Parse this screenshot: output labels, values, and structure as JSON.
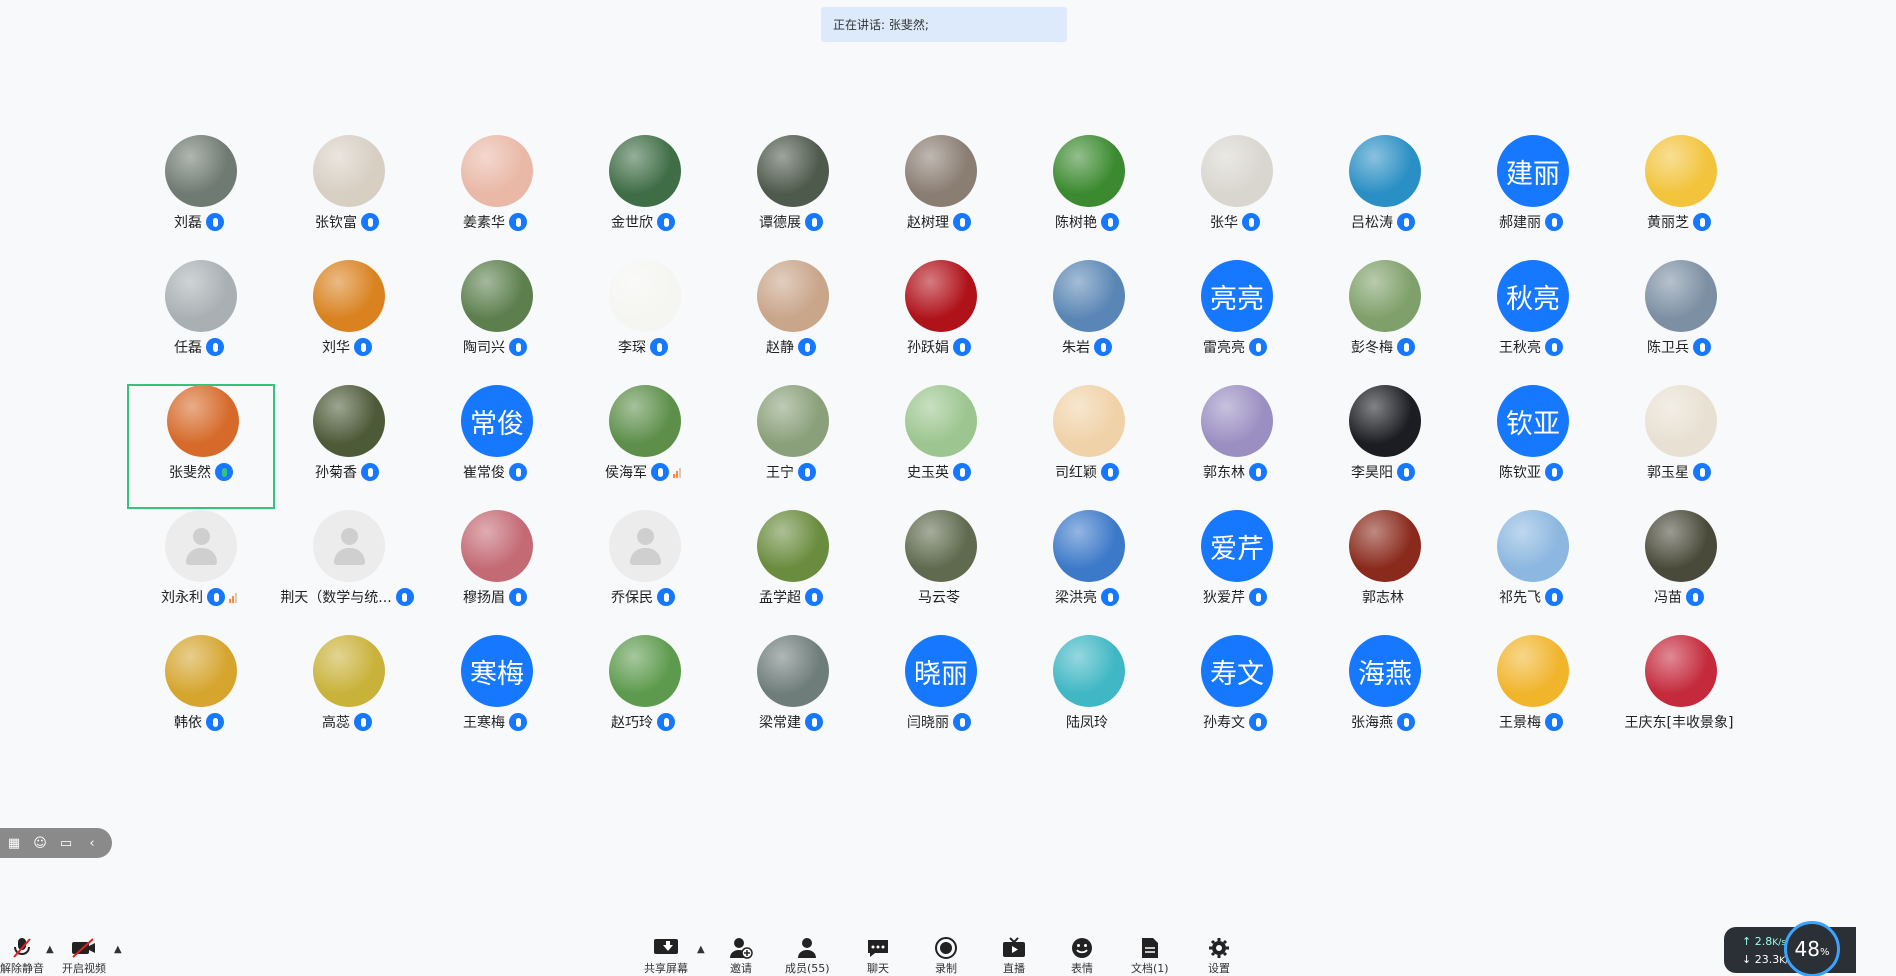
{
  "banner": {
    "text": "正在讲话: 张斐然;"
  },
  "participants": [
    {
      "name": "刘磊",
      "avatar": {
        "kind": "photo",
        "color": "#6f7a72"
      }
    },
    {
      "name": "张钦富",
      "avatar": {
        "kind": "photo",
        "color": "#d8cfc3"
      }
    },
    {
      "name": "姜素华",
      "avatar": {
        "kind": "photo",
        "color": "#e9b8a6"
      }
    },
    {
      "name": "金世欣",
      "avatar": {
        "kind": "photo",
        "color": "#3f6d46"
      }
    },
    {
      "name": "谭德展",
      "avatar": {
        "kind": "photo",
        "color": "#4e5a4c"
      }
    },
    {
      "name": "赵树理",
      "avatar": {
        "kind": "photo",
        "color": "#8a7d72"
      }
    },
    {
      "name": "陈树艳",
      "avatar": {
        "kind": "photo",
        "color": "#3b8a2f"
      }
    },
    {
      "name": "张华",
      "avatar": {
        "kind": "photo",
        "color": "#d9d6cf"
      }
    },
    {
      "name": "吕松涛",
      "avatar": {
        "kind": "photo",
        "color": "#2a8fc4"
      }
    },
    {
      "name": "郝建丽",
      "avatar": {
        "kind": "text",
        "text": "建丽"
      }
    },
    {
      "name": "黄丽芝",
      "avatar": {
        "kind": "photo",
        "color": "#f2c43c"
      }
    },
    {
      "name": "任磊",
      "avatar": {
        "kind": "photo",
        "color": "#a9b0b3"
      }
    },
    {
      "name": "刘华",
      "avatar": {
        "kind": "photo",
        "color": "#d9821f"
      }
    },
    {
      "name": "陶司兴",
      "avatar": {
        "kind": "photo",
        "color": "#5c7f4d"
      }
    },
    {
      "name": "李琛",
      "avatar": {
        "kind": "photo",
        "color": "#f5f5f2"
      }
    },
    {
      "name": "赵静",
      "avatar": {
        "kind": "photo",
        "color": "#c9a58a"
      }
    },
    {
      "name": "孙跃娟",
      "avatar": {
        "kind": "photo",
        "color": "#b0121a"
      }
    },
    {
      "name": "朱岩",
      "avatar": {
        "kind": "photo",
        "color": "#5a86b5"
      }
    },
    {
      "name": "雷亮亮",
      "avatar": {
        "kind": "text",
        "text": "亮亮"
      }
    },
    {
      "name": "彭冬梅",
      "avatar": {
        "kind": "photo",
        "color": "#7fa06a"
      }
    },
    {
      "name": "王秋亮",
      "avatar": {
        "kind": "text",
        "text": "秋亮"
      }
    },
    {
      "name": "陈卫兵",
      "avatar": {
        "kind": "photo",
        "color": "#7c8fa3"
      }
    },
    {
      "name": "张斐然",
      "active": true,
      "avatar": {
        "kind": "photo",
        "color": "#d66a2a"
      }
    },
    {
      "name": "孙菊香",
      "avatar": {
        "kind": "photo",
        "color": "#4d5a38"
      }
    },
    {
      "name": "崔常俊",
      "avatar": {
        "kind": "text",
        "text": "常俊"
      }
    },
    {
      "name": "侯海军",
      "signal": true,
      "avatar": {
        "kind": "photo",
        "color": "#5d8f4a"
      }
    },
    {
      "name": "王宁",
      "avatar": {
        "kind": "photo",
        "color": "#8aa07a"
      }
    },
    {
      "name": "史玉英",
      "avatar": {
        "kind": "photo",
        "color": "#9cc58f"
      }
    },
    {
      "name": "司红颖",
      "avatar": {
        "kind": "photo",
        "color": "#f0d2a8"
      }
    },
    {
      "name": "郭东林",
      "avatar": {
        "kind": "photo",
        "color": "#9b8fc2"
      }
    },
    {
      "name": "李昊阳",
      "avatar": {
        "kind": "photo",
        "color": "#1b1d22"
      }
    },
    {
      "name": "陈钦亚",
      "avatar": {
        "kind": "text",
        "text": "钦亚"
      }
    },
    {
      "name": "郭玉星",
      "avatar": {
        "kind": "photo",
        "color": "#e8e0d2"
      }
    },
    {
      "name": "刘永利",
      "signal": true,
      "avatar": {
        "kind": "default"
      }
    },
    {
      "name": "荆天（数学与统...",
      "avatar": {
        "kind": "default"
      }
    },
    {
      "name": "穆扬眉",
      "avatar": {
        "kind": "photo",
        "color": "#c46a75"
      }
    },
    {
      "name": "乔保民",
      "avatar": {
        "kind": "default"
      }
    },
    {
      "name": "孟学超",
      "avatar": {
        "kind": "photo",
        "color": "#6a8c3e"
      }
    },
    {
      "name": "马云苓",
      "nomic": true,
      "avatar": {
        "kind": "photo",
        "color": "#5f6a4e"
      }
    },
    {
      "name": "梁洪亮",
      "avatar": {
        "kind": "photo",
        "color": "#3c79c9"
      }
    },
    {
      "name": "狄爱芹",
      "avatar": {
        "kind": "text",
        "text": "爱芹"
      }
    },
    {
      "name": "郭志林",
      "nomic": true,
      "avatar": {
        "kind": "photo",
        "color": "#8a2a1c"
      }
    },
    {
      "name": "祁先飞",
      "avatar": {
        "kind": "photo",
        "color": "#8bb7e0"
      }
    },
    {
      "name": "冯苗",
      "avatar": {
        "kind": "photo",
        "color": "#4a4a3a"
      }
    },
    {
      "name": "韩依",
      "avatar": {
        "kind": "photo",
        "color": "#d5a52e"
      }
    },
    {
      "name": "高蕊",
      "avatar": {
        "kind": "photo",
        "color": "#c9b23a"
      }
    },
    {
      "name": "王寒梅",
      "avatar": {
        "kind": "text",
        "text": "寒梅"
      }
    },
    {
      "name": "赵巧玲",
      "avatar": {
        "kind": "photo",
        "color": "#5d9a4d"
      }
    },
    {
      "name": "梁常建",
      "avatar": {
        "kind": "photo",
        "color": "#6f7d7a"
      }
    },
    {
      "name": "闫晓丽",
      "avatar": {
        "kind": "text",
        "text": "晓丽"
      }
    },
    {
      "name": "陆凤玲",
      "nomic": true,
      "avatar": {
        "kind": "photo",
        "color": "#3fb7c4"
      }
    },
    {
      "name": "孙寿文",
      "avatar": {
        "kind": "text",
        "text": "寿文"
      }
    },
    {
      "name": "张海燕",
      "avatar": {
        "kind": "text",
        "text": "海燕"
      }
    },
    {
      "name": "王景梅",
      "avatar": {
        "kind": "photo",
        "color": "#f1b52c"
      }
    },
    {
      "name": "王庆东[丰收景象]",
      "nomic": true,
      "avatar": {
        "kind": "photo",
        "color": "#c42a3c"
      }
    }
  ],
  "toolbar": {
    "unmute": "解除静音",
    "video": "开启视频",
    "share": "共享屏幕",
    "invite": "邀请",
    "members": "成员(55)",
    "chat": "聊天",
    "record": "录制",
    "live": "直播",
    "emoji": "表情",
    "docs": "文档(1)",
    "settings": "设置"
  },
  "network": {
    "up": "2.8",
    "down": "23.3",
    "unit": "K/s",
    "cpu": "48",
    "cpu_unit": "%"
  }
}
